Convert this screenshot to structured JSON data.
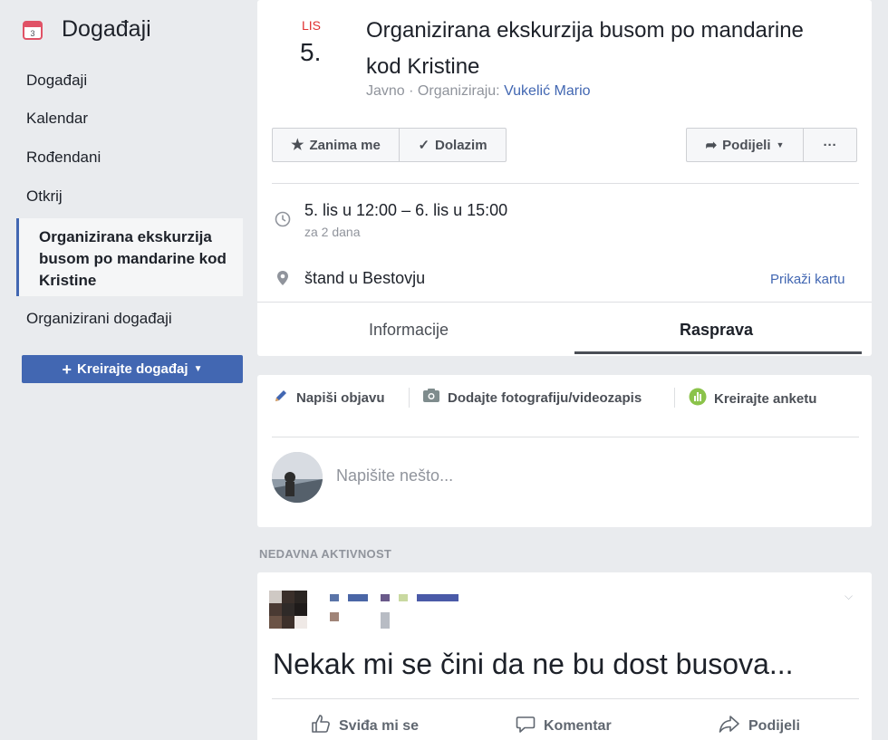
{
  "sidebar": {
    "title": "Događaji",
    "items": [
      "Događaji",
      "Kalendar",
      "Rođendani",
      "Otkrij"
    ],
    "active_item": "Organizirana ekskurzija busom po mandarine kod Kristine",
    "bottom_item": "Organizirani događaji",
    "create_button": "Kreirajte događaj"
  },
  "event": {
    "month": "LIS",
    "day": "5.",
    "title": "Organizirana ekskurzija busom po mandarine kod Kristine",
    "visibility": "Javno · Organiziraju:",
    "organizer": "Vukelić Mario",
    "interested_label": "Zanima me",
    "going_label": "Dolazim",
    "share_label": "Podijeli",
    "more_label": "···",
    "time": "5. lis u 12:00 – 6. lis u 15:00",
    "time_relative": "za 2 dana",
    "location": "štand u Bestovju",
    "map_link": "Prikaži kartu",
    "tabs": [
      "Informacije",
      "Rasprava"
    ]
  },
  "composer": {
    "write_post": "Napiši objavu",
    "add_photo": "Dodajte fotografiju/videozapis",
    "create_poll": "Kreirajte anketu",
    "placeholder": "Napišite nešto..."
  },
  "activity": {
    "heading": "NEDAVNA AKTIVNOST",
    "post_text": "Nekak mi se čini da ne bu dost busova...",
    "like_label": "Sviđa mi se",
    "comment_label": "Komentar",
    "share_label": "Podijeli"
  },
  "colors": {
    "accent": "#4267b2",
    "month_red": "#e03131",
    "background": "#e9ebee"
  }
}
